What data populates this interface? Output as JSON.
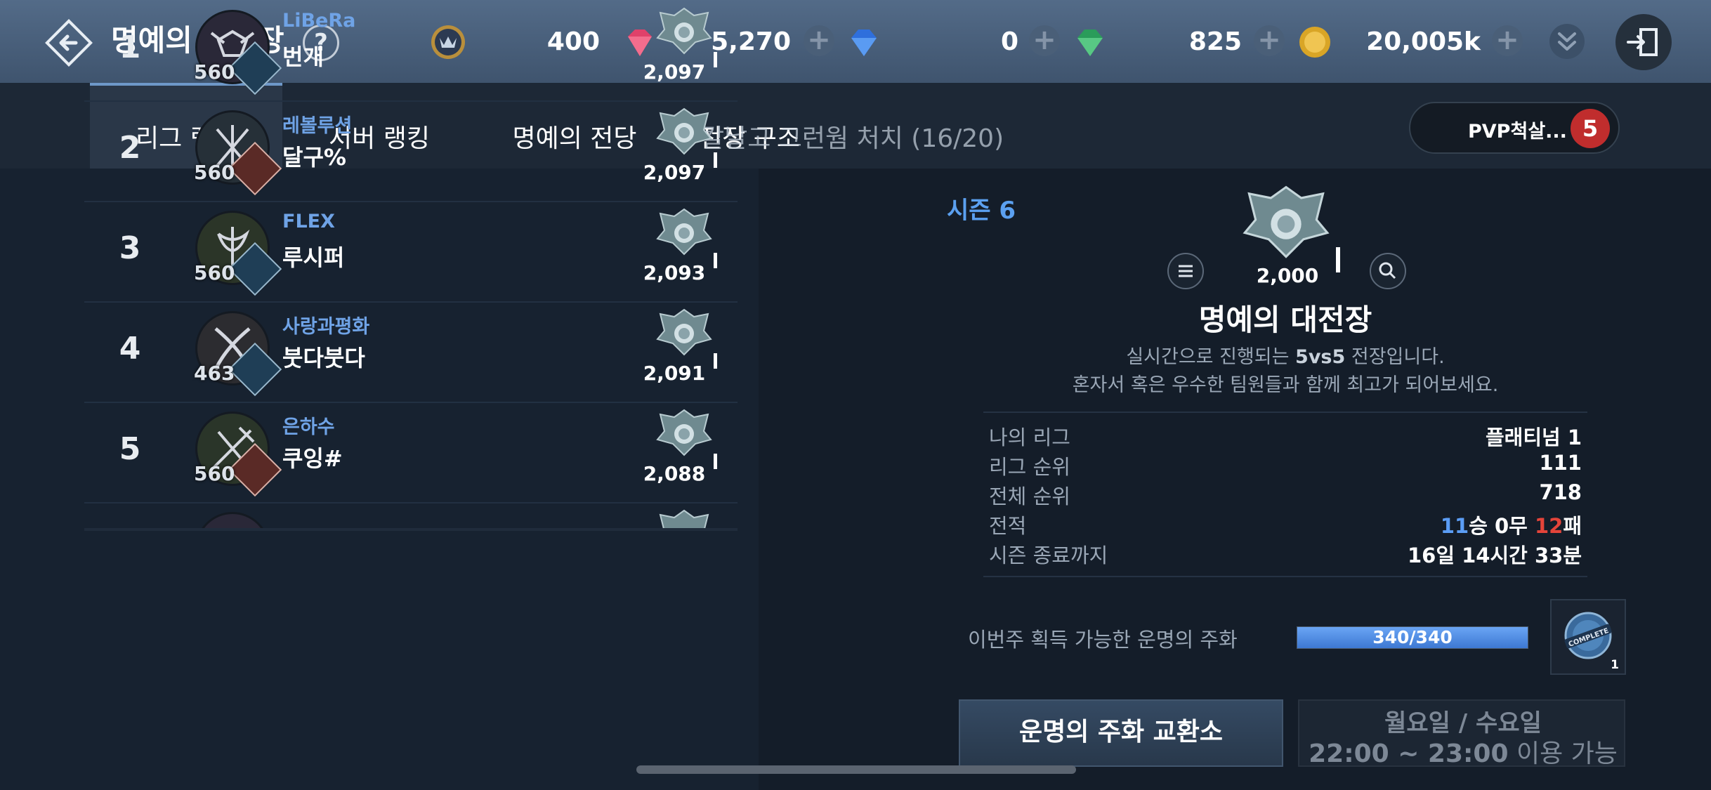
{
  "header": {
    "title": "명예의 대전장",
    "help": "?",
    "currencies": [
      {
        "icon": "honor-medal-icon",
        "value": "400"
      },
      {
        "icon": "red-gem-icon",
        "value": "5,270"
      },
      {
        "icon": "blue-diamond-icon",
        "value": "0"
      },
      {
        "icon": "green-gem-icon",
        "value": "825"
      },
      {
        "icon": "gold-coin-icon",
        "value": "20,005k"
      }
    ],
    "plus": "+"
  },
  "tabs": [
    "리그 랭킹",
    "서버 랭킹",
    "명예의 전당",
    "전장 구조"
  ],
  "quest_overlay": "칼날고 그런웜 처치 (16/20)",
  "pvp": {
    "label": "PVP척살...",
    "badge": "5"
  },
  "ranking": [
    {
      "rank": "1",
      "level": "560",
      "guild": "LiBeRa",
      "name": "번개",
      "score": "2,097"
    },
    {
      "rank": "2",
      "level": "560",
      "guild": "레볼루션",
      "name": "달구%",
      "score": "2,097"
    },
    {
      "rank": "3",
      "level": "560",
      "guild": "FLEX",
      "name": "루시퍼",
      "score": "2,093"
    },
    {
      "rank": "4",
      "level": "463",
      "guild": "사랑과평화",
      "name": "붓다붓다",
      "score": "2,091"
    },
    {
      "rank": "5",
      "level": "560",
      "guild": "은하수",
      "name": "쿠잉#",
      "score": "2,088"
    }
  ],
  "season": {
    "label": "시즌 6",
    "score": "2,000",
    "title": "명예의 대전장",
    "desc1_pre": "실시간으로 진행되는 ",
    "desc1_bold": "5vs5",
    "desc1_post": " 전장입니다.",
    "desc2": "혼자서 혹은 우수한 팀원들과 함께 최고가 되어보세요."
  },
  "stats": {
    "my_league_label": "나의 리그",
    "my_league_value": "플래티넘 1",
    "league_rank_label": "리그 순위",
    "league_rank_value": "111",
    "total_rank_label": "전체 순위",
    "total_rank_value": "718",
    "record_label": "전적",
    "record_wins": "11",
    "record_win_unit": "승 ",
    "record_draws": "0",
    "record_draw_unit": "무 ",
    "record_losses": "12",
    "record_loss_unit": "패",
    "season_end_label": "시즌 종료까지",
    "season_end_days": "16",
    "season_end_days_unit": "일 ",
    "season_end_hours": "14",
    "season_end_hours_unit": "시간 ",
    "season_end_mins": "33",
    "season_end_mins_unit": "분"
  },
  "fate": {
    "label": "이번주 획득 가능한 운명의 주화",
    "progress_text": "340/340",
    "progress_fraction": 1.0,
    "coin_count": "1",
    "coin_stamp": "COMPLETE"
  },
  "exchange_button": "운명의 주화 교환소",
  "schedule": {
    "days": "월요일 / 수요일",
    "time": "22:00 ~ 23:00",
    "suffix": " 이용 가능"
  },
  "colors": {
    "accent_blue": "#5b9df5",
    "loss_red": "#e4443a",
    "badge_red": "#c02d2d"
  }
}
